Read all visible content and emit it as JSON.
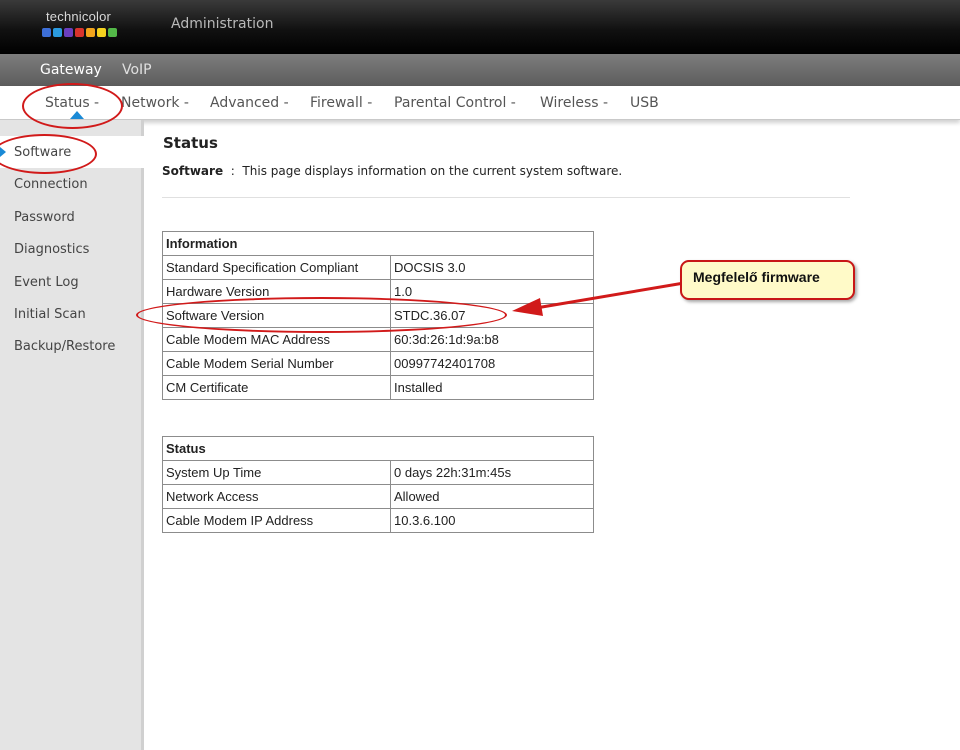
{
  "brand": {
    "logo_text": "technicolor",
    "logo_colors": [
      "#3d6fd8",
      "#2b9be0",
      "#6a3fbf",
      "#d8332d",
      "#f2a41c",
      "#f4d21f",
      "#53b848"
    ]
  },
  "header": {
    "title": "Administration"
  },
  "nav1": {
    "items": [
      "Gateway",
      "VoIP"
    ],
    "active": "Gateway"
  },
  "nav2": {
    "items": [
      "Status -",
      "Network -",
      "Advanced -",
      "Firewall -",
      "Parental Control -",
      "Wireless -",
      "USB"
    ],
    "active": "Status -"
  },
  "sidebar": {
    "items": [
      "Software",
      "Connection",
      "Password",
      "Diagnostics",
      "Event Log",
      "Initial Scan",
      "Backup/Restore"
    ],
    "active": "Software"
  },
  "main": {
    "title": "Status",
    "description_label": "Software",
    "description_sep": ":",
    "description_text": "This page displays information on the current system software."
  },
  "information_table": {
    "header": "Information",
    "rows": [
      [
        "Standard Specification Compliant",
        "DOCSIS 3.0"
      ],
      [
        "Hardware Version",
        "1.0"
      ],
      [
        "Software Version",
        "STDC.36.07"
      ],
      [
        "Cable Modem MAC Address",
        "60:3d:26:1d:9a:b8"
      ],
      [
        "Cable Modem Serial Number",
        "00997742401708"
      ],
      [
        "CM Certificate",
        "Installed"
      ]
    ]
  },
  "status_table": {
    "header": "Status",
    "rows": [
      [
        "System Up Time",
        "0 days 22h:31m:45s"
      ],
      [
        "Network Access",
        "Allowed"
      ],
      [
        "Cable Modem IP Address",
        "10.3.6.100"
      ]
    ]
  },
  "annotation": {
    "callout_text": "Megfelelő firmware",
    "color": "#d11a1a"
  },
  "colors": {
    "accent": "#1a8ad6",
    "header_dark": "#111111",
    "sidebar_bg": "#e4e4e4"
  }
}
